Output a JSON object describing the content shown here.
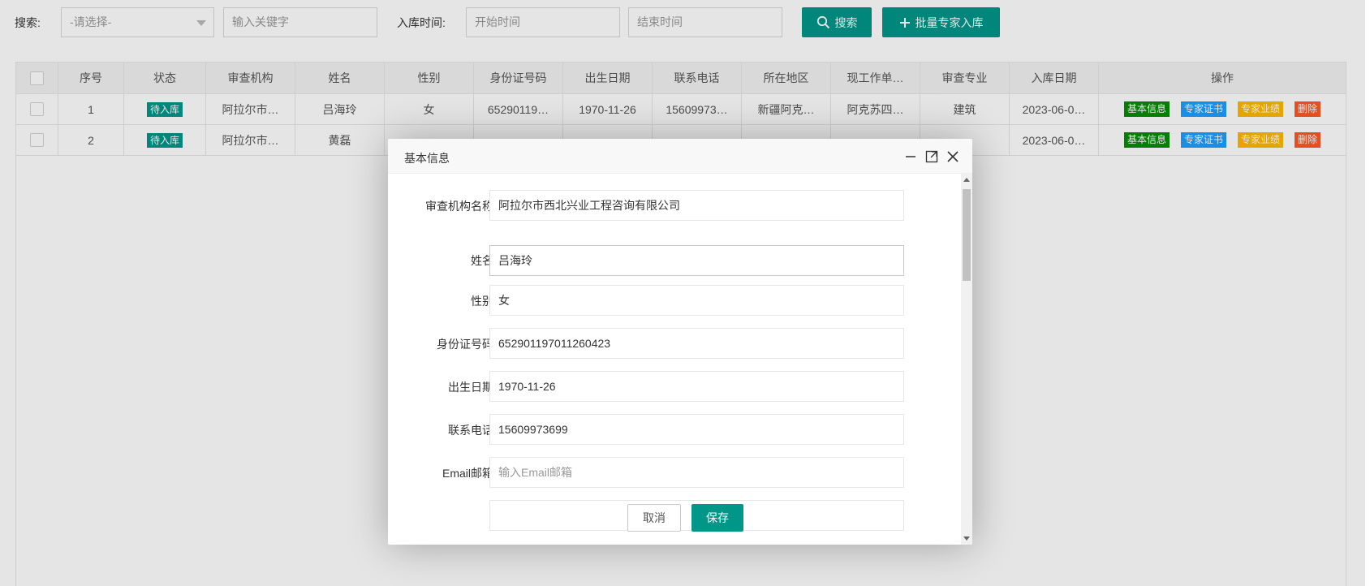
{
  "search": {
    "label": "搜索:",
    "select_placeholder": "-请选择-",
    "keyword_placeholder": "输入关键字",
    "date_label": "入库时间:",
    "start_placeholder": "开始时间",
    "end_placeholder": "结束时间",
    "search_btn": "搜索",
    "batch_btn": "批量专家入库"
  },
  "table": {
    "columns": [
      "序号",
      "状态",
      "审查机构",
      "姓名",
      "性别",
      "身份证号码",
      "出生日期",
      "联系电话",
      "所在地区",
      "现工作单…",
      "审查专业",
      "入库日期",
      "操作"
    ],
    "rows": [
      {
        "no": "1",
        "status": "待入库",
        "org": "阿拉尔市…",
        "name": "吕海玲",
        "gender": "女",
        "id": "65290119…",
        "birth": "1970-11-26",
        "phone": "15609973…",
        "region": "新疆阿克…",
        "work": "阿克苏四…",
        "major": "建筑",
        "date": "2023-06-0…"
      },
      {
        "no": "2",
        "status": "待入库",
        "org": "阿拉尔市…",
        "name": "黄磊",
        "gender": "",
        "id": "",
        "birth": "",
        "phone": "",
        "region": "",
        "work": "",
        "major": "",
        "date": "2023-06-0…"
      }
    ],
    "actions": {
      "basic": "基本信息",
      "cert": "专家证书",
      "perf": "专家业绩",
      "delete": "删除"
    }
  },
  "modal": {
    "title": "基本信息",
    "fields": [
      {
        "label": "审查机构名称",
        "value": "阿拉尔市西北兴业工程咨询有限公司"
      },
      {
        "label": "姓名",
        "value": "吕海玲"
      },
      {
        "label": "性别",
        "value": "女"
      },
      {
        "label": "身份证号码",
        "value": "652901197011260423"
      },
      {
        "label": "出生日期",
        "value": "1970-11-26"
      },
      {
        "label": "联系电话",
        "value": "15609973699"
      },
      {
        "label": "Email邮箱",
        "value": "",
        "placeholder": "输入Email邮箱"
      }
    ],
    "cancel_btn": "取消",
    "save_btn": "保存"
  },
  "colors": {
    "primary": "#009688",
    "green": "#058e05",
    "blue": "#1e9fff",
    "orange": "#ffb800",
    "red": "#ff5722"
  },
  "icons": [
    "search-icon",
    "plus-icon",
    "minimize-icon",
    "maximize-icon",
    "close-icon"
  ]
}
